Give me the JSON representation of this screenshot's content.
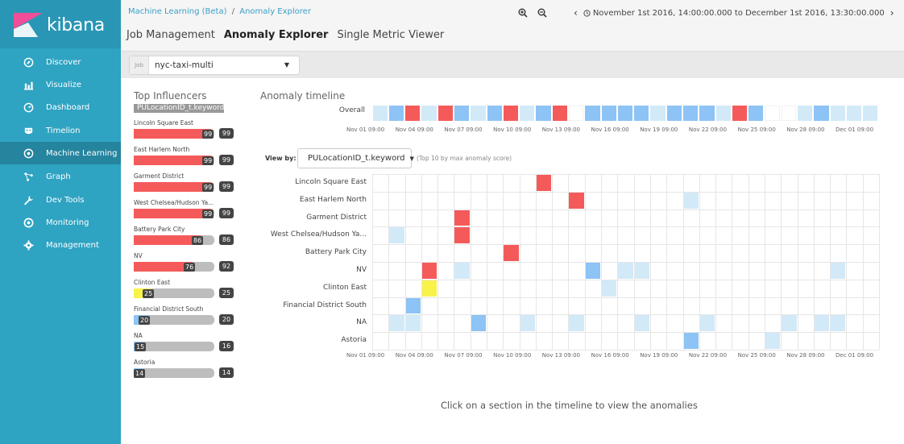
{
  "app": {
    "logo_text": "kibana"
  },
  "sidebar": {
    "items": [
      {
        "label": "Discover",
        "icon": "compass-icon",
        "active": false
      },
      {
        "label": "Visualize",
        "icon": "bar-chart-icon",
        "active": false
      },
      {
        "label": "Dashboard",
        "icon": "dashboard-icon",
        "active": false
      },
      {
        "label": "Timelion",
        "icon": "timelion-icon",
        "active": false
      },
      {
        "label": "Machine Learning",
        "icon": "machine-learning-icon",
        "active": true
      },
      {
        "label": "Graph",
        "icon": "graph-icon",
        "active": false
      },
      {
        "label": "Dev Tools",
        "icon": "wrench-icon",
        "active": false
      },
      {
        "label": "Monitoring",
        "icon": "eye-icon",
        "active": false
      },
      {
        "label": "Management",
        "icon": "gear-icon",
        "active": false
      }
    ]
  },
  "header": {
    "breadcrumb_root": "Machine Learning (Beta)",
    "breadcrumb_sep": "/",
    "breadcrumb_current": "Anomaly Explorer",
    "tabs": [
      {
        "label": "Job Management",
        "active": false
      },
      {
        "label": "Anomaly Explorer",
        "active": true
      },
      {
        "label": "Single Metric Viewer",
        "active": false
      }
    ],
    "time_range": "November 1st 2016, 14:00:00.000 to December 1st 2016, 13:30:00.000"
  },
  "job": {
    "tag": "Job",
    "name": "nyc-taxi-multi"
  },
  "influencers": {
    "title": "Top Influencers",
    "field": "PULocationID_t.keyword",
    "items": [
      {
        "label": "Lincoln Square East",
        "score": 99,
        "max": 99,
        "color": "#f55a5a"
      },
      {
        "label": "East Harlem North",
        "score": 99,
        "max": 99,
        "color": "#f55a5a"
      },
      {
        "label": "Garment District",
        "score": 99,
        "max": 99,
        "color": "#f55a5a"
      },
      {
        "label": "West Chelsea/Hudson Ya...",
        "score": 99,
        "max": 99,
        "color": "#f55a5a"
      },
      {
        "label": "Battery Park City",
        "score": 86,
        "max": 86,
        "color": "#f55a5a"
      },
      {
        "label": "NV",
        "score": 76,
        "max": 92,
        "color": "#f55a5a"
      },
      {
        "label": "Clinton East",
        "score": 25,
        "max": 25,
        "color": "#f8f24a"
      },
      {
        "label": "Financial District South",
        "score": 20,
        "max": 20,
        "color": "#8dc3f5"
      },
      {
        "label": "NA",
        "score": 15,
        "max": 16,
        "color": "#8dc3f5"
      },
      {
        "label": "Astoria",
        "score": 14,
        "max": 14,
        "color": "#8dc3f5"
      }
    ]
  },
  "timeline": {
    "title": "Anomaly timeline",
    "overall_label": "Overall",
    "axis_labels": [
      "Nov 01 09:00",
      "Nov 04 09:00",
      "Nov 07 09:00",
      "Nov 10 09:00",
      "Nov 13 09:00",
      "Nov 16 09:00",
      "Nov 19 09:00",
      "Nov 22 09:00",
      "Nov 25 09:00",
      "Nov 28 09:00",
      "Dec 01 09:00"
    ],
    "colors": {
      "red": "#f55a5a",
      "yellow": "#f8f24a",
      "blue": "#8dc3f5",
      "lightblue": "#d2e9f8",
      "empty": "#ffffff"
    },
    "overall_cells": [
      "lightblue",
      "blue",
      "red",
      "lightblue",
      "red",
      "blue",
      "lightblue",
      "blue",
      "red",
      "lightblue",
      "blue",
      "red",
      "empty",
      "blue",
      "blue",
      "blue",
      "blue",
      "lightblue",
      "blue",
      "blue",
      "blue",
      "lightblue",
      "red",
      "blue",
      "empty",
      "empty",
      "lightblue",
      "blue",
      "lightblue",
      "lightblue",
      "lightblue"
    ],
    "view_by_label": "View by:",
    "view_by_value": "PULocationID_t.keyword",
    "view_by_note": "(Top 10 by max anomaly score)",
    "rows": [
      {
        "label": "Lincoln Square East",
        "cells": {
          "10": "red"
        }
      },
      {
        "label": "East Harlem North",
        "cells": {
          "12": "red",
          "19": "lightblue"
        }
      },
      {
        "label": "Garment District",
        "cells": {
          "5": "red"
        }
      },
      {
        "label": "West Chelsea/Hudson Ya...",
        "cells": {
          "1": "lightblue",
          "5": "red"
        }
      },
      {
        "label": "Battery Park City",
        "cells": {
          "8": "red"
        }
      },
      {
        "label": "NV",
        "cells": {
          "3": "red",
          "5": "lightblue",
          "13": "blue",
          "15": "lightblue",
          "16": "lightblue",
          "28": "lightblue"
        }
      },
      {
        "label": "Clinton East",
        "cells": {
          "3": "yellow",
          "14": "lightblue"
        }
      },
      {
        "label": "Financial District South",
        "cells": {
          "2": "blue"
        }
      },
      {
        "label": "NA",
        "cells": {
          "1": "lightblue",
          "2": "lightblue",
          "6": "blue",
          "9": "lightblue",
          "12": "lightblue",
          "16": "lightblue",
          "20": "lightblue",
          "25": "lightblue",
          "27": "lightblue",
          "28": "lightblue"
        }
      },
      {
        "label": "Astoria",
        "cells": {
          "19": "blue",
          "24": "lightblue"
        }
      }
    ]
  },
  "empty_message": "Click on a section in the timeline to view the anomalies"
}
